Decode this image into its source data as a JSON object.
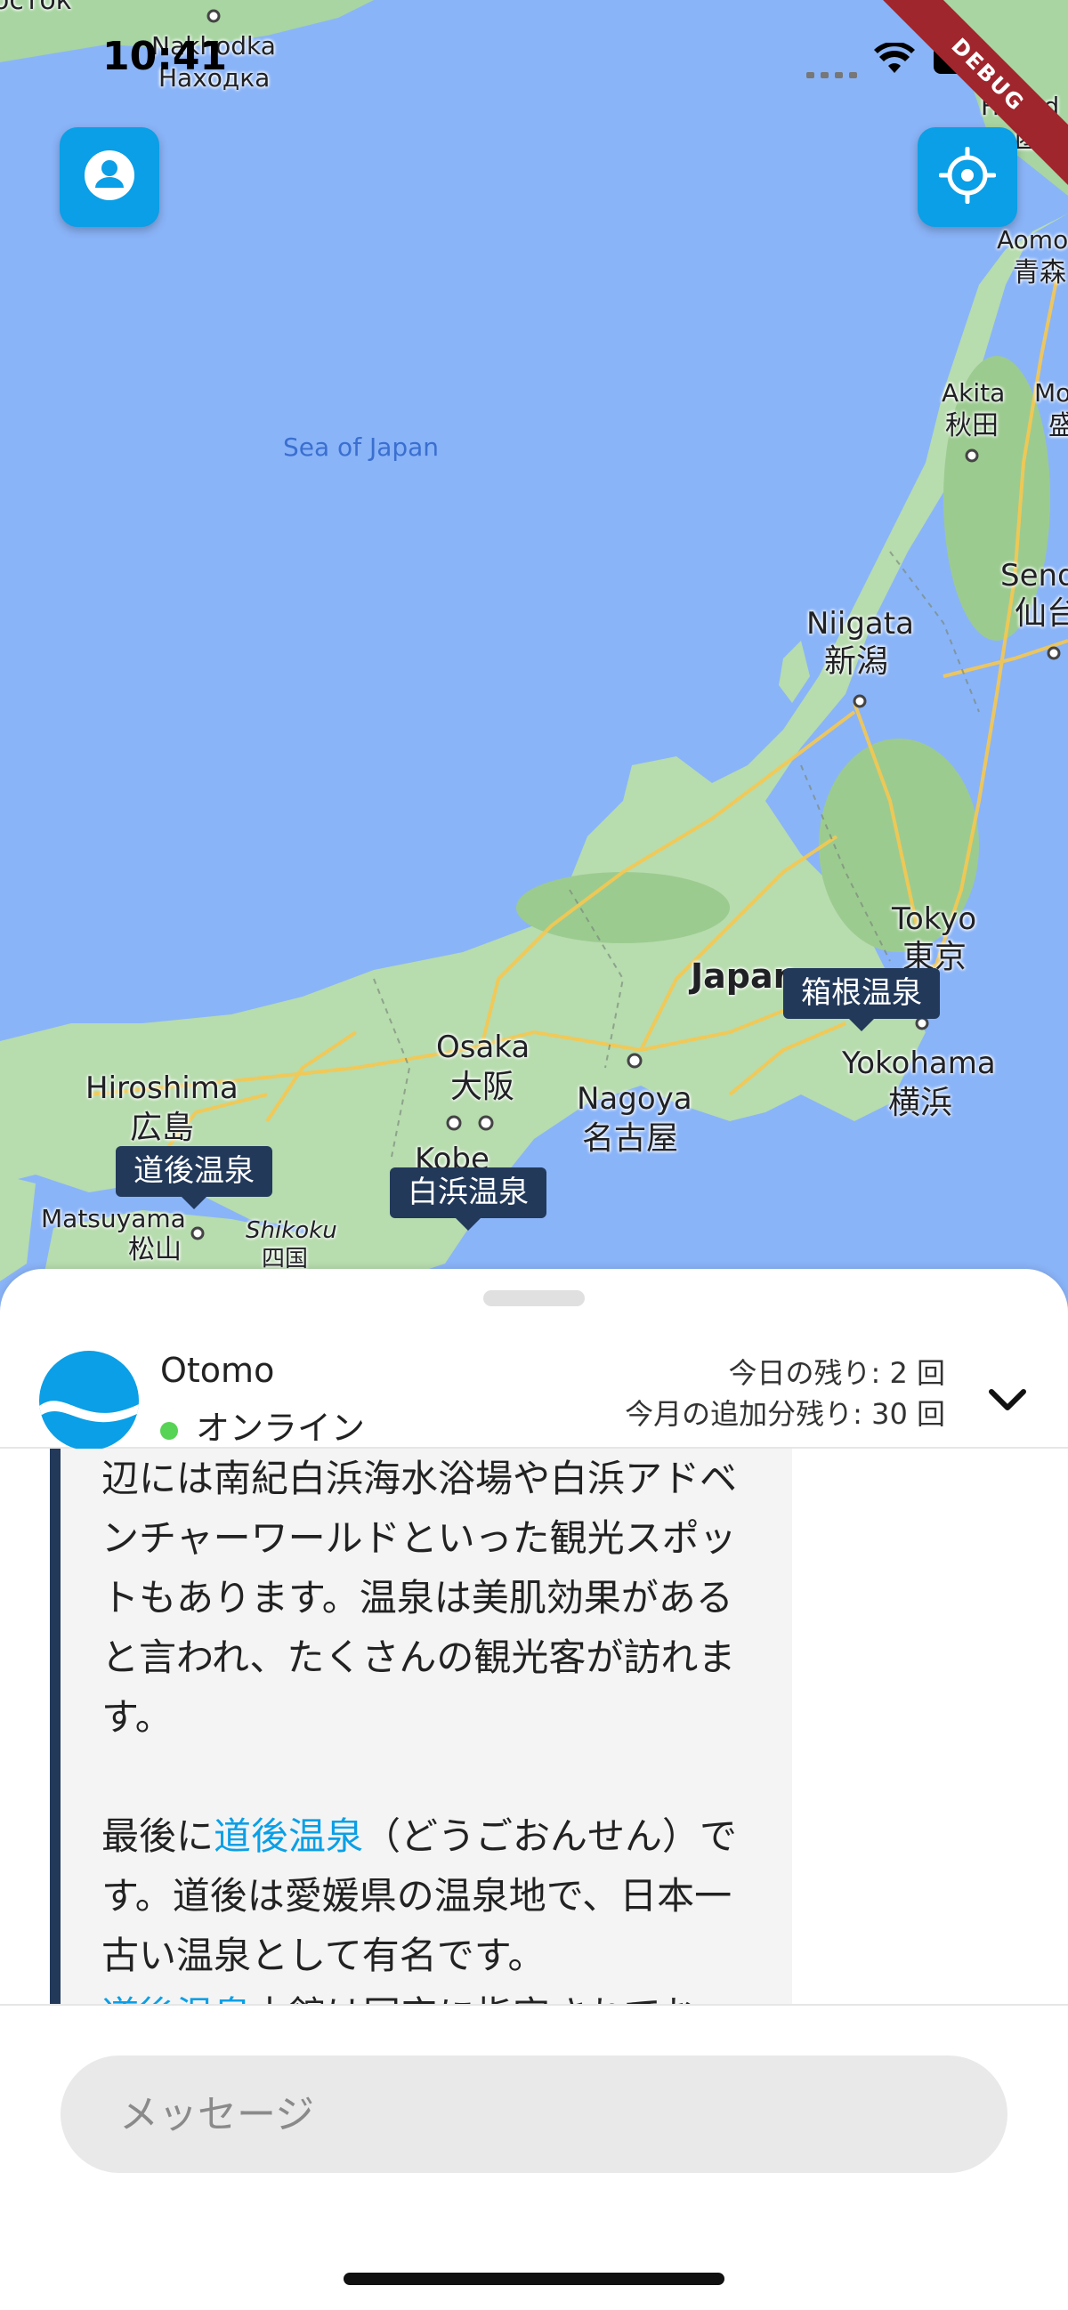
{
  "status_bar": {
    "time": "10:41"
  },
  "debug_banner": "DEBUG",
  "map": {
    "sea_label": "Sea of Japan",
    "labels": [
      {
        "id": "vostok",
        "text": "осток"
      },
      {
        "id": "nakhodka_en",
        "text": "Nakhodka"
      },
      {
        "id": "nakhodka_ru",
        "text": "Находка"
      },
      {
        "id": "hakodate_en",
        "text": "Hakod"
      },
      {
        "id": "hakodate_ja",
        "text": "函館"
      },
      {
        "id": "aomori_en",
        "text": "Aomo"
      },
      {
        "id": "aomori_ja",
        "text": "青森"
      },
      {
        "id": "akita_en",
        "text": "Akita"
      },
      {
        "id": "akita_ja",
        "text": "秋田"
      },
      {
        "id": "morioka_en",
        "text": "Mo"
      },
      {
        "id": "morioka_ja",
        "text": "盛"
      },
      {
        "id": "sendai_en",
        "text": "Send"
      },
      {
        "id": "sendai_ja",
        "text": "仙台"
      },
      {
        "id": "niigata_en",
        "text": "Niigata"
      },
      {
        "id": "niigata_ja",
        "text": "新潟"
      },
      {
        "id": "tokyo_en",
        "text": "Tokyo"
      },
      {
        "id": "tokyo_ja",
        "text": "東京"
      },
      {
        "id": "japan",
        "text": "Japan"
      },
      {
        "id": "yokohama_en",
        "text": "Yokohama"
      },
      {
        "id": "yokohama_ja",
        "text": "横浜"
      },
      {
        "id": "osaka_en",
        "text": "Osaka"
      },
      {
        "id": "osaka_ja",
        "text": "大阪"
      },
      {
        "id": "nagoya_en",
        "text": "Nagoya"
      },
      {
        "id": "nagoya_ja",
        "text": "名古屋"
      },
      {
        "id": "kobe_en",
        "text": "Kobe"
      },
      {
        "id": "hiroshima_en",
        "text": "Hiroshima"
      },
      {
        "id": "hiroshima_ja",
        "text": "広島"
      },
      {
        "id": "matsuyama_en",
        "text": "Matsuyama"
      },
      {
        "id": "matsuyama_ja",
        "text": "松山"
      },
      {
        "id": "shikoku_en",
        "text": "Shikoku"
      },
      {
        "id": "shikoku_ja",
        "text": "四国"
      }
    ],
    "markers": [
      {
        "id": "hakone",
        "label": "箱根温泉"
      },
      {
        "id": "dogo",
        "label": "道後温泉"
      },
      {
        "id": "shirahama",
        "label": "白浜温泉"
      }
    ]
  },
  "sheet": {
    "bot_name": "Otomo",
    "status": "オンライン",
    "quota_today": "今日の残り: 2 回",
    "quota_month": "今月の追加分残り: 30 回"
  },
  "chat": {
    "p1": "辺には南紀白浜海水浴場や白浜アドベンチャーワールドといった観光スポットもあります。温泉は美肌効果があると言われ、たくさんの観光客が訪れます。",
    "p2_prefix": "最後に",
    "p2_link": "道後温泉",
    "p2_rest": "（どうごおんせん）です。道後は愛媛県の温泉地で、日本一古い温泉として有名です。",
    "p3_link": "道後温泉",
    "p3_rest": "本館は国宝に指定されてお"
  },
  "input": {
    "placeholder": "メッセージ"
  }
}
